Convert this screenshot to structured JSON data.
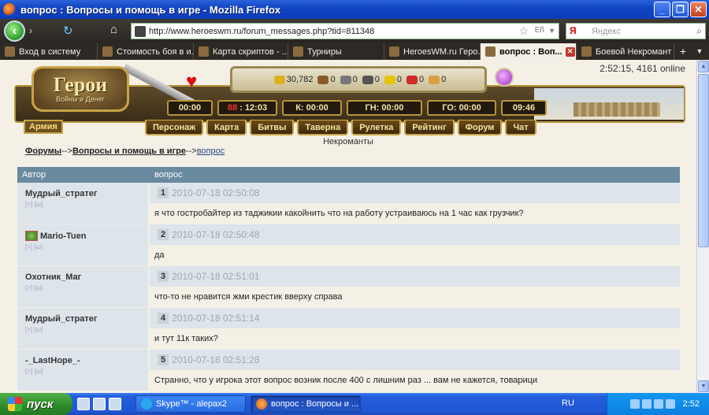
{
  "window": {
    "title": "вопрос : Вопросы и помощь в игре - Mozilla Firefox",
    "buttons": [
      "_",
      "❐",
      "✕"
    ]
  },
  "navbar": {
    "url": "http://www.heroeswm.ru/forum_messages.php?tid=811348",
    "search_placeholder": "Яндекс",
    "search_logo": "Я"
  },
  "tabs": [
    {
      "label": "Вход в систему",
      "active": false
    },
    {
      "label": "Стоимость боя в и...",
      "active": false
    },
    {
      "label": "Карта скриптов - ...",
      "active": false
    },
    {
      "label": "Турниры",
      "active": false
    },
    {
      "label": "HeroesWM.ru Геро...",
      "active": false
    },
    {
      "label": "вопрос : Воп...",
      "active": true
    },
    {
      "label": "Боевой Некромант ...",
      "active": false
    }
  ],
  "game": {
    "online": "2:52:15, 4161 online",
    "logo_big": "Герои",
    "logo_small": "Войны и Денег",
    "resources": [
      "30,782",
      "0",
      "0",
      "0",
      "0",
      "0",
      "0"
    ],
    "timers": [
      {
        "label": "00:00"
      },
      {
        "label": "12:03",
        "prefix": "88"
      },
      {
        "label": "К: 00:00"
      },
      {
        "label": "ГН: 00:00"
      },
      {
        "label": "ГО: 00:00"
      },
      {
        "label": "09:46"
      }
    ],
    "army": "Армия",
    "menu": [
      "Персонаж",
      "Карта",
      "Битвы",
      "Таверна",
      "Рулетка",
      "Рейтинг",
      "Форум",
      "Чат"
    ],
    "faction": "Некроманты"
  },
  "breadcrumb": {
    "forums": "Форумы",
    "sep1": "-->",
    "section": "Вопросы и помощь в игре",
    "sep2": "-->",
    "topic": "вопрос"
  },
  "forum": {
    "col_author": "Автор",
    "col_topic": "вопрос",
    "post_icons": "[>] [ш]",
    "posts": [
      {
        "author": "Мудрый_стратег",
        "num": "1",
        "date": "2010-07-18 02:50:08",
        "text": "я что гостробайтер из таджикии какойнить что на работу устраиваюсь на 1 час как грузчик?"
      },
      {
        "author": "Mario-Tuen",
        "num": "2",
        "date": "2010-07-18 02:50:48",
        "text": "да"
      },
      {
        "author": "Охотник_Маг",
        "num": "3",
        "date": "2010-07-18 02:51:01",
        "text": "что-то не нравится жми крестик вверху справа"
      },
      {
        "author": "Мудрый_стратег",
        "num": "4",
        "date": "2010-07-18 02:51:14",
        "text": "и тут 11к таких?"
      },
      {
        "author": "-_LastHope_-",
        "num": "5",
        "date": "2010-07-18 02:51:28",
        "text": "Странно, что у игрока этот вопрос возник после 400 с лишним раз ... вам не кажется, товарици"
      }
    ]
  },
  "taskbar": {
    "start": "пуск",
    "items": [
      {
        "label": "Skype™ - alepax2",
        "active": false
      },
      {
        "label": "вопрос : Вопросы и ...",
        "active": true
      }
    ],
    "lang": "RU",
    "clock": "2:52"
  }
}
